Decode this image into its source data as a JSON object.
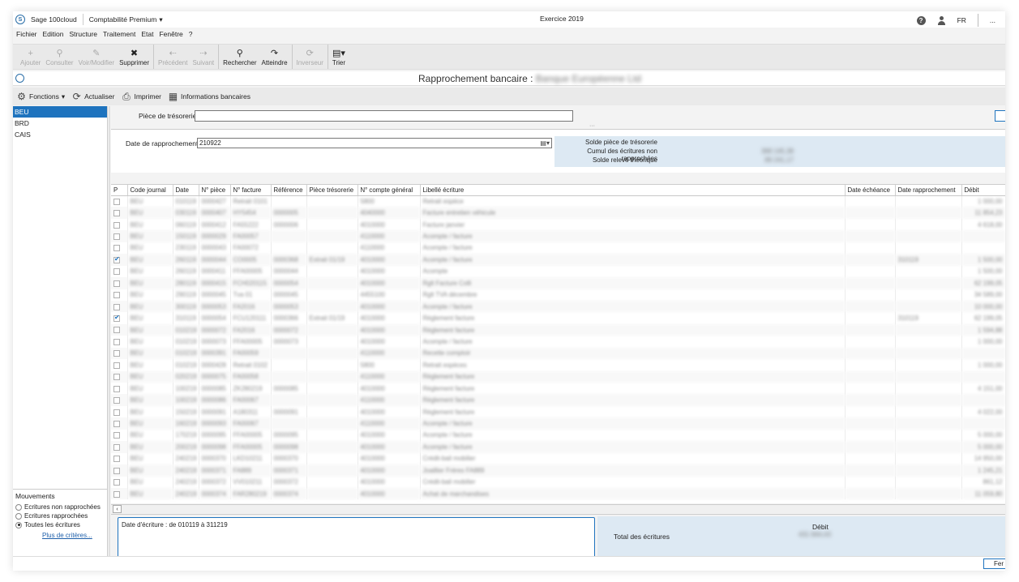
{
  "titlebar": {
    "app_name": "Sage 100cloud",
    "product": "Comptabilité Premium",
    "exercise": "Exercice 2019",
    "lang": "FR",
    "min_btn": "..."
  },
  "menu": [
    "Fichier",
    "Edition",
    "Structure",
    "Traitement",
    "Etat",
    "Fenêtre",
    "?"
  ],
  "toolbar": [
    [
      {
        "label": "Ajouter",
        "icon": "+",
        "disabled": true
      },
      {
        "label": "Consulter",
        "icon": "⚲",
        "disabled": true
      },
      {
        "label": "Voir/Modifier",
        "icon": "✎",
        "disabled": true
      },
      {
        "label": "Supprimer",
        "icon": "✖",
        "disabled": false
      }
    ],
    [
      {
        "label": "Précédent",
        "icon": "⇠",
        "disabled": true
      },
      {
        "label": "Suivant",
        "icon": "⇢",
        "disabled": true
      }
    ],
    [
      {
        "label": "Rechercher",
        "icon": "⚲",
        "disabled": false
      },
      {
        "label": "Atteindre",
        "icon": "↷",
        "disabled": false
      }
    ],
    [
      {
        "label": "Inverseur",
        "icon": "⟳",
        "disabled": true
      }
    ],
    [
      {
        "label": "Trier",
        "icon": "▤▾",
        "disabled": false
      }
    ]
  ],
  "window": {
    "title": "Rapprochement bancaire :",
    "bank_name": "Banque Européenne Ltd"
  },
  "funcbar": {
    "fonctions": "Fonctions",
    "actualiser": "Actualiser",
    "imprimer": "Imprimer",
    "informations": "Informations bancaires"
  },
  "journals": [
    "BEU",
    "BRD",
    "CAIS"
  ],
  "movements": {
    "title": "Mouvements",
    "options": [
      {
        "label": "Ecritures non rapprochées",
        "checked": false
      },
      {
        "label": "Ecritures rapprochées",
        "checked": false
      },
      {
        "label": "Toutes les écritures",
        "checked": true
      }
    ],
    "more": "Plus de critères..."
  },
  "piece": {
    "label": "Pièce de trésorerie",
    "value": ""
  },
  "rapprochement": {
    "label": "Date de rapprochement",
    "value": "210922"
  },
  "summary": {
    "lines": [
      "Solde pièce de trésorerie",
      "Cumul des écritures non rapprochées",
      "Solde relevé théorique"
    ],
    "values": [
      "",
      "368 145,38",
      "89 241,17"
    ]
  },
  "columns": [
    "P",
    "Code journal",
    "Date",
    "N° pièce",
    "N° facture",
    "Référence",
    "Pièce trésorerie",
    "N° compte général",
    "Libellé écriture",
    "Date échéance",
    "Date rapprochement",
    "Débit"
  ],
  "rows": [
    {
      "p": false,
      "code": "BEU",
      "date": "010119",
      "piece": "0000427",
      "facture": "Retrait 0101",
      "ref": "",
      "tres": "",
      "compte": "5800",
      "libelle": "Retrait espèce",
      "echeance": "",
      "rappr": "",
      "debit": "1 000,00"
    },
    {
      "p": false,
      "code": "BEU",
      "date": "030119",
      "piece": "0000407",
      "facture": "HY5454",
      "ref": "0000005",
      "tres": "",
      "compte": "4040000",
      "libelle": "Facture entretien véhicule",
      "echeance": "",
      "rappr": "",
      "debit": "11 854,23"
    },
    {
      "p": false,
      "code": "BEU",
      "date": "060119",
      "piece": "0000412",
      "facture": "FA55222",
      "ref": "0000006",
      "tres": "",
      "compte": "4010000",
      "libelle": "Facture janvier",
      "echeance": "",
      "rappr": "",
      "debit": "4 618,00"
    },
    {
      "p": false,
      "code": "BEU",
      "date": "150119",
      "piece": "0000029",
      "facture": "FA00057",
      "ref": "",
      "tres": "",
      "compte": "4110000",
      "libelle": "Acompte / facture",
      "echeance": "",
      "rappr": "",
      "debit": ""
    },
    {
      "p": false,
      "code": "BEU",
      "date": "230119",
      "piece": "0000043",
      "facture": "FA00072",
      "ref": "",
      "tres": "",
      "compte": "4110000",
      "libelle": "Acompte / facture",
      "echeance": "",
      "rappr": "",
      "debit": ""
    },
    {
      "p": true,
      "code": "BEU",
      "date": "260119",
      "piece": "0000044",
      "facture": "CO0005",
      "ref": "0000368",
      "tres": "Extrait 01/19",
      "compte": "4010000",
      "libelle": "Acompte / facture",
      "echeance": "",
      "rappr": "310119",
      "debit": "1 500,00"
    },
    {
      "p": false,
      "code": "BEU",
      "date": "260119",
      "piece": "0000411",
      "facture": "FFA00005",
      "ref": "0000044",
      "tres": "",
      "compte": "4010000",
      "libelle": "Acompte",
      "echeance": "",
      "rappr": "",
      "debit": "1 500,00"
    },
    {
      "p": false,
      "code": "BEU",
      "date": "280119",
      "piece": "0000415",
      "facture": "FCH020115",
      "ref": "0000054",
      "tres": "",
      "compte": "4010000",
      "libelle": "Rglt Facture Colli",
      "echeance": "",
      "rappr": "",
      "debit": "62 199,05"
    },
    {
      "p": false,
      "code": "BEU",
      "date": "290119",
      "piece": "0000045",
      "facture": "Tva 01",
      "ref": "0000045",
      "tres": "",
      "compte": "4455100",
      "libelle": "Rglt TVA décembre",
      "echeance": "",
      "rappr": "",
      "debit": "34 589,00"
    },
    {
      "p": false,
      "code": "BEU",
      "date": "300119",
      "piece": "0000053",
      "facture": "FA2016",
      "ref": "0000053",
      "tres": "",
      "compte": "4010000",
      "libelle": "Acompte / facture",
      "echeance": "",
      "rappr": "",
      "debit": "10 000,00"
    },
    {
      "p": true,
      "code": "BEU",
      "date": "310119",
      "piece": "0000054",
      "facture": "FCU120111",
      "ref": "0000366",
      "tres": "Extrait 01/19",
      "compte": "4010000",
      "libelle": "Règlement facture",
      "echeance": "",
      "rappr": "310119",
      "debit": "62 199,05"
    },
    {
      "p": false,
      "code": "BEU",
      "date": "010219",
      "piece": "0000072",
      "facture": "FA2016",
      "ref": "0000072",
      "tres": "",
      "compte": "4010000",
      "libelle": "Règlement facture",
      "echeance": "",
      "rappr": "",
      "debit": "1 594,88"
    },
    {
      "p": false,
      "code": "BEU",
      "date": "010219",
      "piece": "0000073",
      "facture": "FFA00005",
      "ref": "0000073",
      "tres": "",
      "compte": "4010000",
      "libelle": "Acompte / facture",
      "echeance": "",
      "rappr": "",
      "debit": "1 000,00"
    },
    {
      "p": false,
      "code": "BEU",
      "date": "010219",
      "piece": "0000391",
      "facture": "FA00059",
      "ref": "",
      "tres": "",
      "compte": "4110000",
      "libelle": "Recette comptoir",
      "echeance": "",
      "rappr": "",
      "debit": ""
    },
    {
      "p": false,
      "code": "BEU",
      "date": "010219",
      "piece": "0000428",
      "facture": "Retrait 0102",
      "ref": "",
      "tres": "",
      "compte": "5800",
      "libelle": "Retrait espèces",
      "echeance": "",
      "rappr": "",
      "debit": "1 000,00"
    },
    {
      "p": false,
      "code": "BEU",
      "date": "020219",
      "piece": "0000075",
      "facture": "FA00058",
      "ref": "",
      "tres": "",
      "compte": "4110000",
      "libelle": "Règlement facture",
      "echeance": "",
      "rappr": "",
      "debit": ""
    },
    {
      "p": false,
      "code": "BEU",
      "date": "100219",
      "piece": "0000085",
      "facture": "ZK280219",
      "ref": "0000085",
      "tres": "",
      "compte": "4010000",
      "libelle": "Règlement facture",
      "echeance": "",
      "rappr": "",
      "debit": "4 151,00"
    },
    {
      "p": false,
      "code": "BEU",
      "date": "100219",
      "piece": "0000086",
      "facture": "FA00067",
      "ref": "",
      "tres": "",
      "compte": "4110000",
      "libelle": "Règlement facture",
      "echeance": "",
      "rappr": "",
      "debit": ""
    },
    {
      "p": false,
      "code": "BEU",
      "date": "150219",
      "piece": "0000091",
      "facture": "A180311",
      "ref": "0000091",
      "tres": "",
      "compte": "4010000",
      "libelle": "Règlement facture",
      "echeance": "",
      "rappr": "",
      "debit": "4 022,00"
    },
    {
      "p": false,
      "code": "BEU",
      "date": "160219",
      "piece": "0000093",
      "facture": "FA00067",
      "ref": "",
      "tres": "",
      "compte": "4110000",
      "libelle": "Acompte / facture",
      "echeance": "",
      "rappr": "",
      "debit": ""
    },
    {
      "p": false,
      "code": "BEU",
      "date": "170219",
      "piece": "0000095",
      "facture": "FFA00005",
      "ref": "0000095",
      "tres": "",
      "compte": "4010000",
      "libelle": "Acompte / facture",
      "echeance": "",
      "rappr": "",
      "debit": "5 000,00"
    },
    {
      "p": false,
      "code": "BEU",
      "date": "200219",
      "piece": "0000098",
      "facture": "FFA00005",
      "ref": "0000098",
      "tres": "",
      "compte": "4010000",
      "libelle": "Acompte / facture",
      "echeance": "",
      "rappr": "",
      "debit": "5 000,00"
    },
    {
      "p": false,
      "code": "BEU",
      "date": "240219",
      "piece": "0000370",
      "facture": "LKD10211",
      "ref": "0000370",
      "tres": "",
      "compte": "4010000",
      "libelle": "Crédit-bail mobilier",
      "echeance": "",
      "rappr": "",
      "debit": "14 950,00"
    },
    {
      "p": false,
      "code": "BEU",
      "date": "240219",
      "piece": "0000371",
      "facture": "FA889",
      "ref": "0000371",
      "tres": "",
      "compte": "4010000",
      "libelle": "Joaillier Frères FA889",
      "echeance": "",
      "rappr": "",
      "debit": "1 245,21"
    },
    {
      "p": false,
      "code": "BEU",
      "date": "240219",
      "piece": "0000372",
      "facture": "VV010211",
      "ref": "0000372",
      "tres": "",
      "compte": "4010000",
      "libelle": "Crédit-bail mobilier",
      "echeance": "",
      "rappr": "",
      "debit": "861,12"
    },
    {
      "p": false,
      "code": "BEU",
      "date": "240219",
      "piece": "0000374",
      "facture": "FAR280219",
      "ref": "0000374",
      "tres": "",
      "compte": "4010000",
      "libelle": "Achat de marchandises",
      "echeance": "",
      "rappr": "",
      "debit": "11 059,80"
    }
  ],
  "filter": {
    "text": "Date d'écriture : de 010119 à 311219"
  },
  "totals": {
    "label": "Total des écritures",
    "head": "Débit",
    "value": "431 844,43"
  },
  "close_btn": "Fer"
}
